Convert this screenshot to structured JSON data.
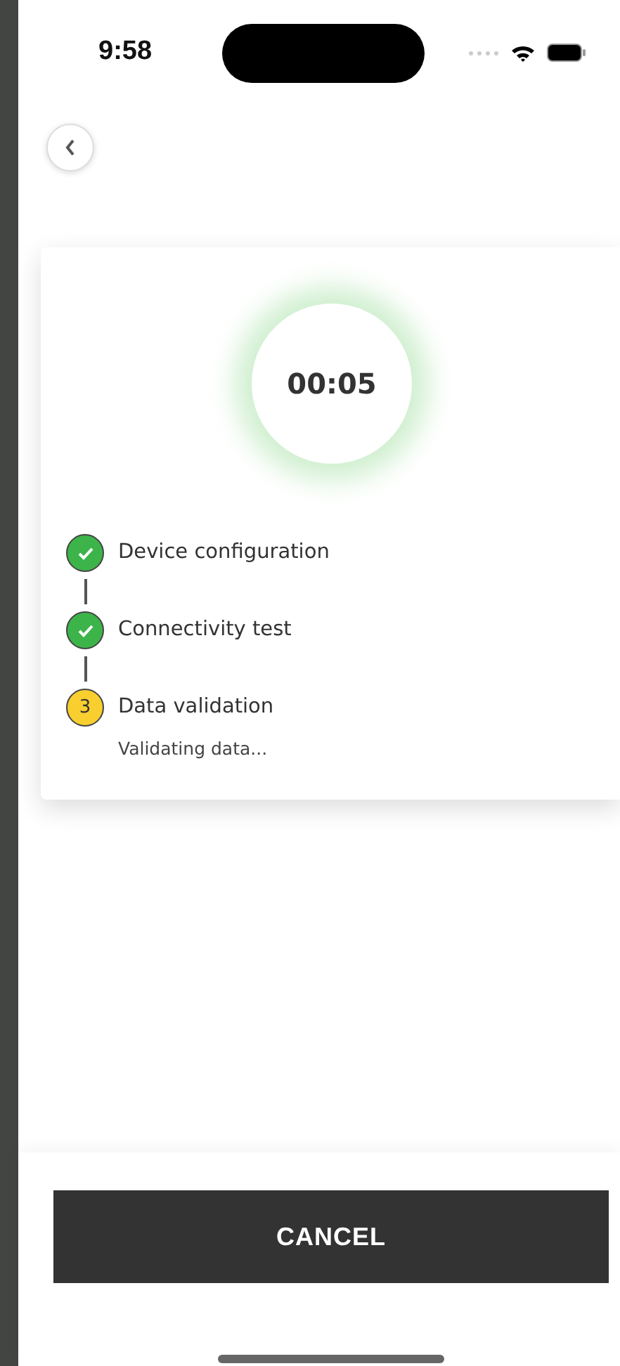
{
  "status_bar": {
    "time": "9:58"
  },
  "timer": {
    "text": "00:05"
  },
  "steps": [
    {
      "label": "Device configuration",
      "completed": true
    },
    {
      "label": "Connectivity test",
      "completed": true
    },
    {
      "label": "Data validation",
      "completed": false,
      "number": "3",
      "detail": "Validating data..."
    }
  ],
  "buttons": [
    {
      "label": "CANCEL"
    }
  ]
}
